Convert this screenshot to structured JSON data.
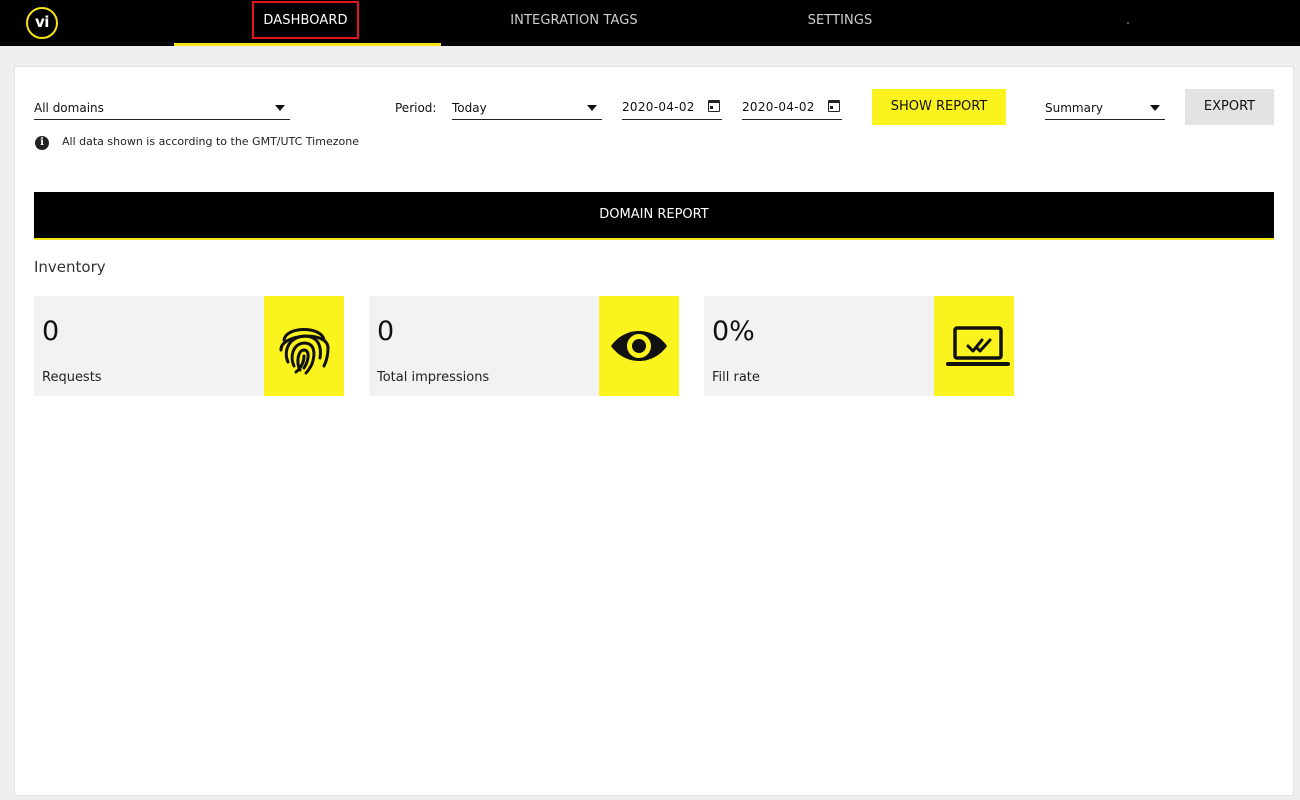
{
  "nav": {
    "logo": "vi",
    "items": [
      "DASHBOARD",
      "INTEGRATION TAGS",
      "SETTINGS"
    ]
  },
  "filters": {
    "domain": "All domains",
    "period_label": "Period:",
    "period": "Today",
    "date_from": "2020-04-02",
    "date_to": "2020-04-02",
    "show_report": "SHOW REPORT",
    "view": "Summary",
    "export": "EXPORT",
    "timezone_note": "All data shown is according to the GMT/UTC Timezone"
  },
  "report": {
    "title": "DOMAIN REPORT",
    "section": "Inventory",
    "stats": [
      {
        "value": "0",
        "label": "Requests",
        "icon": "fingerprint-icon"
      },
      {
        "value": "0",
        "label": "Total impressions",
        "icon": "eye-icon"
      },
      {
        "value": "0%",
        "label": "Fill rate",
        "icon": "laptop-check-icon"
      }
    ]
  },
  "colors": {
    "accent": "#fbf31d",
    "nav_bg": "#000000",
    "highlight": "#e5131b"
  }
}
